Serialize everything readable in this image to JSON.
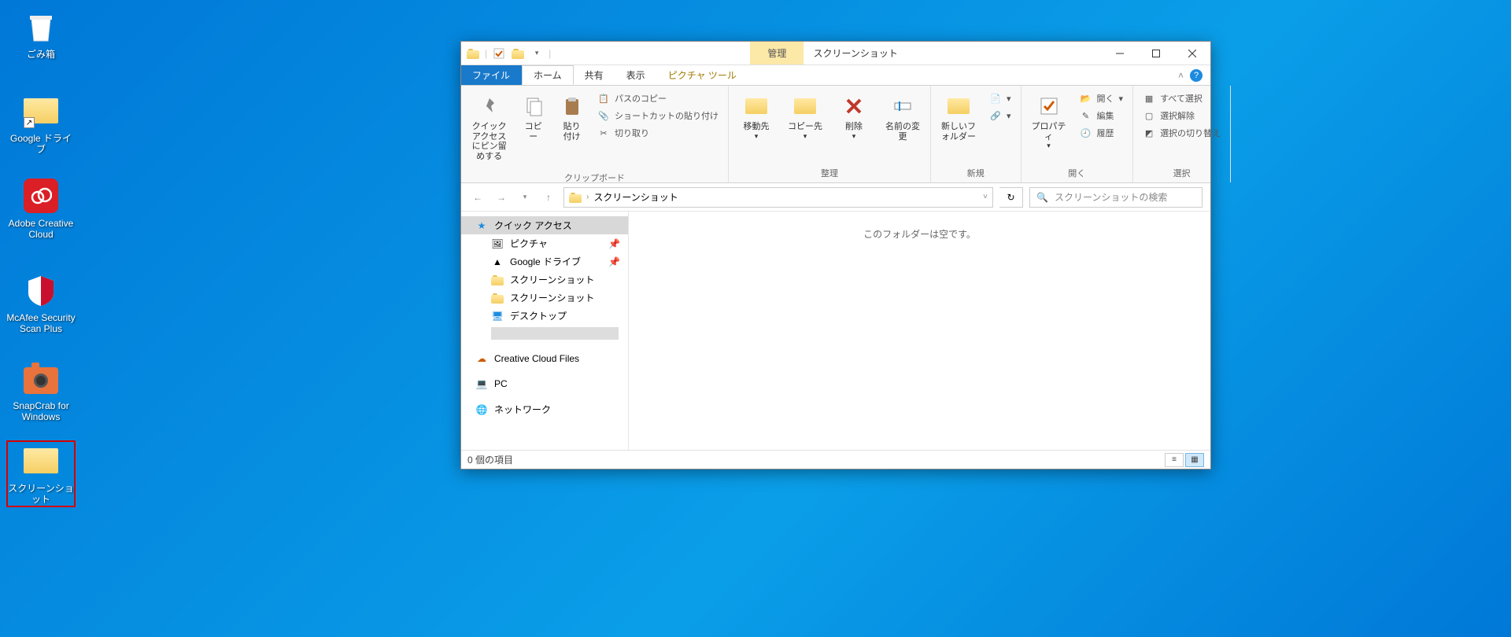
{
  "desktop": {
    "icons": [
      {
        "label": "ごみ箱",
        "kind": "recycle"
      },
      {
        "label": "Google ドライブ",
        "kind": "folder-shortcut"
      },
      {
        "label": "Adobe Creative Cloud",
        "kind": "adobe"
      },
      {
        "label": "McAfee Security Scan Plus",
        "kind": "mcafee"
      },
      {
        "label": "SnapCrab for Windows",
        "kind": "snapcrab"
      },
      {
        "label": "スクリーンショット",
        "kind": "folder",
        "highlighted": true
      }
    ]
  },
  "explorer": {
    "title_manage": "管理",
    "title": "スクリーンショット",
    "tabs": {
      "file": "ファイル",
      "home": "ホーム",
      "share": "共有",
      "view": "表示",
      "context": "ピクチャ ツール"
    },
    "ribbon": {
      "pin": "クイック アクセスにピン留めする",
      "copy": "コピー",
      "paste": "貼り付け",
      "copy_path": "パスのコピー",
      "paste_shortcut": "ショートカットの貼り付け",
      "cut": "切り取り",
      "clipboard_group": "クリップボード",
      "move_to": "移動先",
      "copy_to": "コピー先",
      "delete": "削除",
      "rename": "名前の変更",
      "organize_group": "整理",
      "new_folder": "新しいフォルダー",
      "new_group": "新規",
      "properties": "プロパティ",
      "open": "開く",
      "edit": "編集",
      "history": "履歴",
      "open_group": "開く",
      "select_all": "すべて選択",
      "select_none": "選択解除",
      "invert_selection": "選択の切り替え",
      "selection_group": "選択"
    },
    "address": {
      "crumbs": [
        "スクリーンショット"
      ]
    },
    "search_placeholder": "スクリーンショットの検索",
    "nav": {
      "quick_access": "クイック アクセス",
      "pictures": "ピクチャ",
      "gdrive": "Google ドライブ",
      "screenshots1": "スクリーンショット",
      "screenshots2": "スクリーンショット",
      "desktop": "デスクトップ",
      "cc_files": "Creative Cloud Files",
      "pc": "PC",
      "network": "ネットワーク"
    },
    "empty_folder": "このフォルダーは空です。",
    "status": "0 個の項目"
  }
}
